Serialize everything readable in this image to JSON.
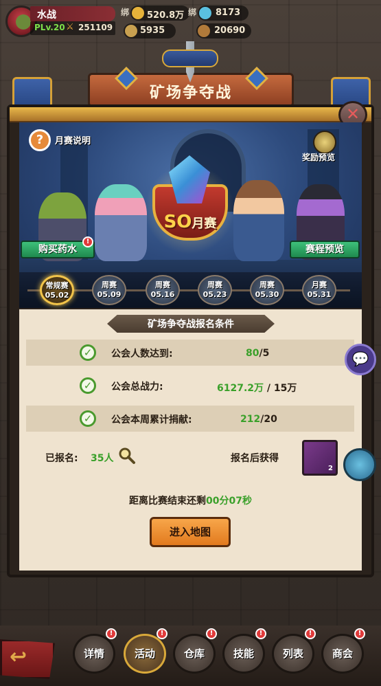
{
  "player": {
    "name": "水战",
    "level": "PLv.20",
    "power": "251109"
  },
  "resources": {
    "bound_label": "绑",
    "bound_gold": "520.8万",
    "bound_gem": "8173",
    "stars": "5935",
    "coins": "20690"
  },
  "title": "矿场争夺战",
  "help_label": "月赛说明",
  "reward_preview_label": "奖励预览",
  "emblem": {
    "season": "SO",
    "type": "月赛"
  },
  "buy_potion_label": "购买药水",
  "schedule_preview_label": "赛程预览",
  "schedule": [
    {
      "type": "常规赛",
      "date": "05.02",
      "active": true
    },
    {
      "type": "周赛",
      "date": "05.09",
      "active": false
    },
    {
      "type": "周赛",
      "date": "05.16",
      "active": false
    },
    {
      "type": "周赛",
      "date": "05.23",
      "active": false
    },
    {
      "type": "周赛",
      "date": "05.30",
      "active": false
    },
    {
      "type": "月赛",
      "date": "05.31",
      "active": false
    }
  ],
  "conditions_title": "矿场争夺战报名条件",
  "conditions": [
    {
      "label": "公会人数达到:",
      "current": "80",
      "separator": "/",
      "required": "5"
    },
    {
      "label": "公会总战力:",
      "current": "6127.2万",
      "separator": " / ",
      "required": "15万"
    },
    {
      "label": "公会本周累计捐献:",
      "current": "212",
      "separator": "/",
      "required": "20"
    }
  ],
  "registered": {
    "label": "已报名:",
    "count": "35人"
  },
  "after_register_label": "报名后获得",
  "reward_item_qty": "2",
  "timer": {
    "prefix": "距离比赛结束还剩",
    "value": "00分07秒"
  },
  "enter_map_label": "进入地图",
  "red_dot_mark": "!",
  "nav": [
    {
      "label": "详情",
      "active": false
    },
    {
      "label": "活动",
      "active": true
    },
    {
      "label": "仓库",
      "active": false
    },
    {
      "label": "技能",
      "active": false
    },
    {
      "label": "列表",
      "active": false
    },
    {
      "label": "商会",
      "active": false
    }
  ],
  "icons": {
    "help": "?",
    "close": "✕",
    "check": "✓",
    "chat": "💬",
    "back": "↩"
  },
  "colors": {
    "accent_green": "#3aa02a",
    "button_orange": "#f7a64a",
    "panel_cream": "#efe3cf"
  }
}
